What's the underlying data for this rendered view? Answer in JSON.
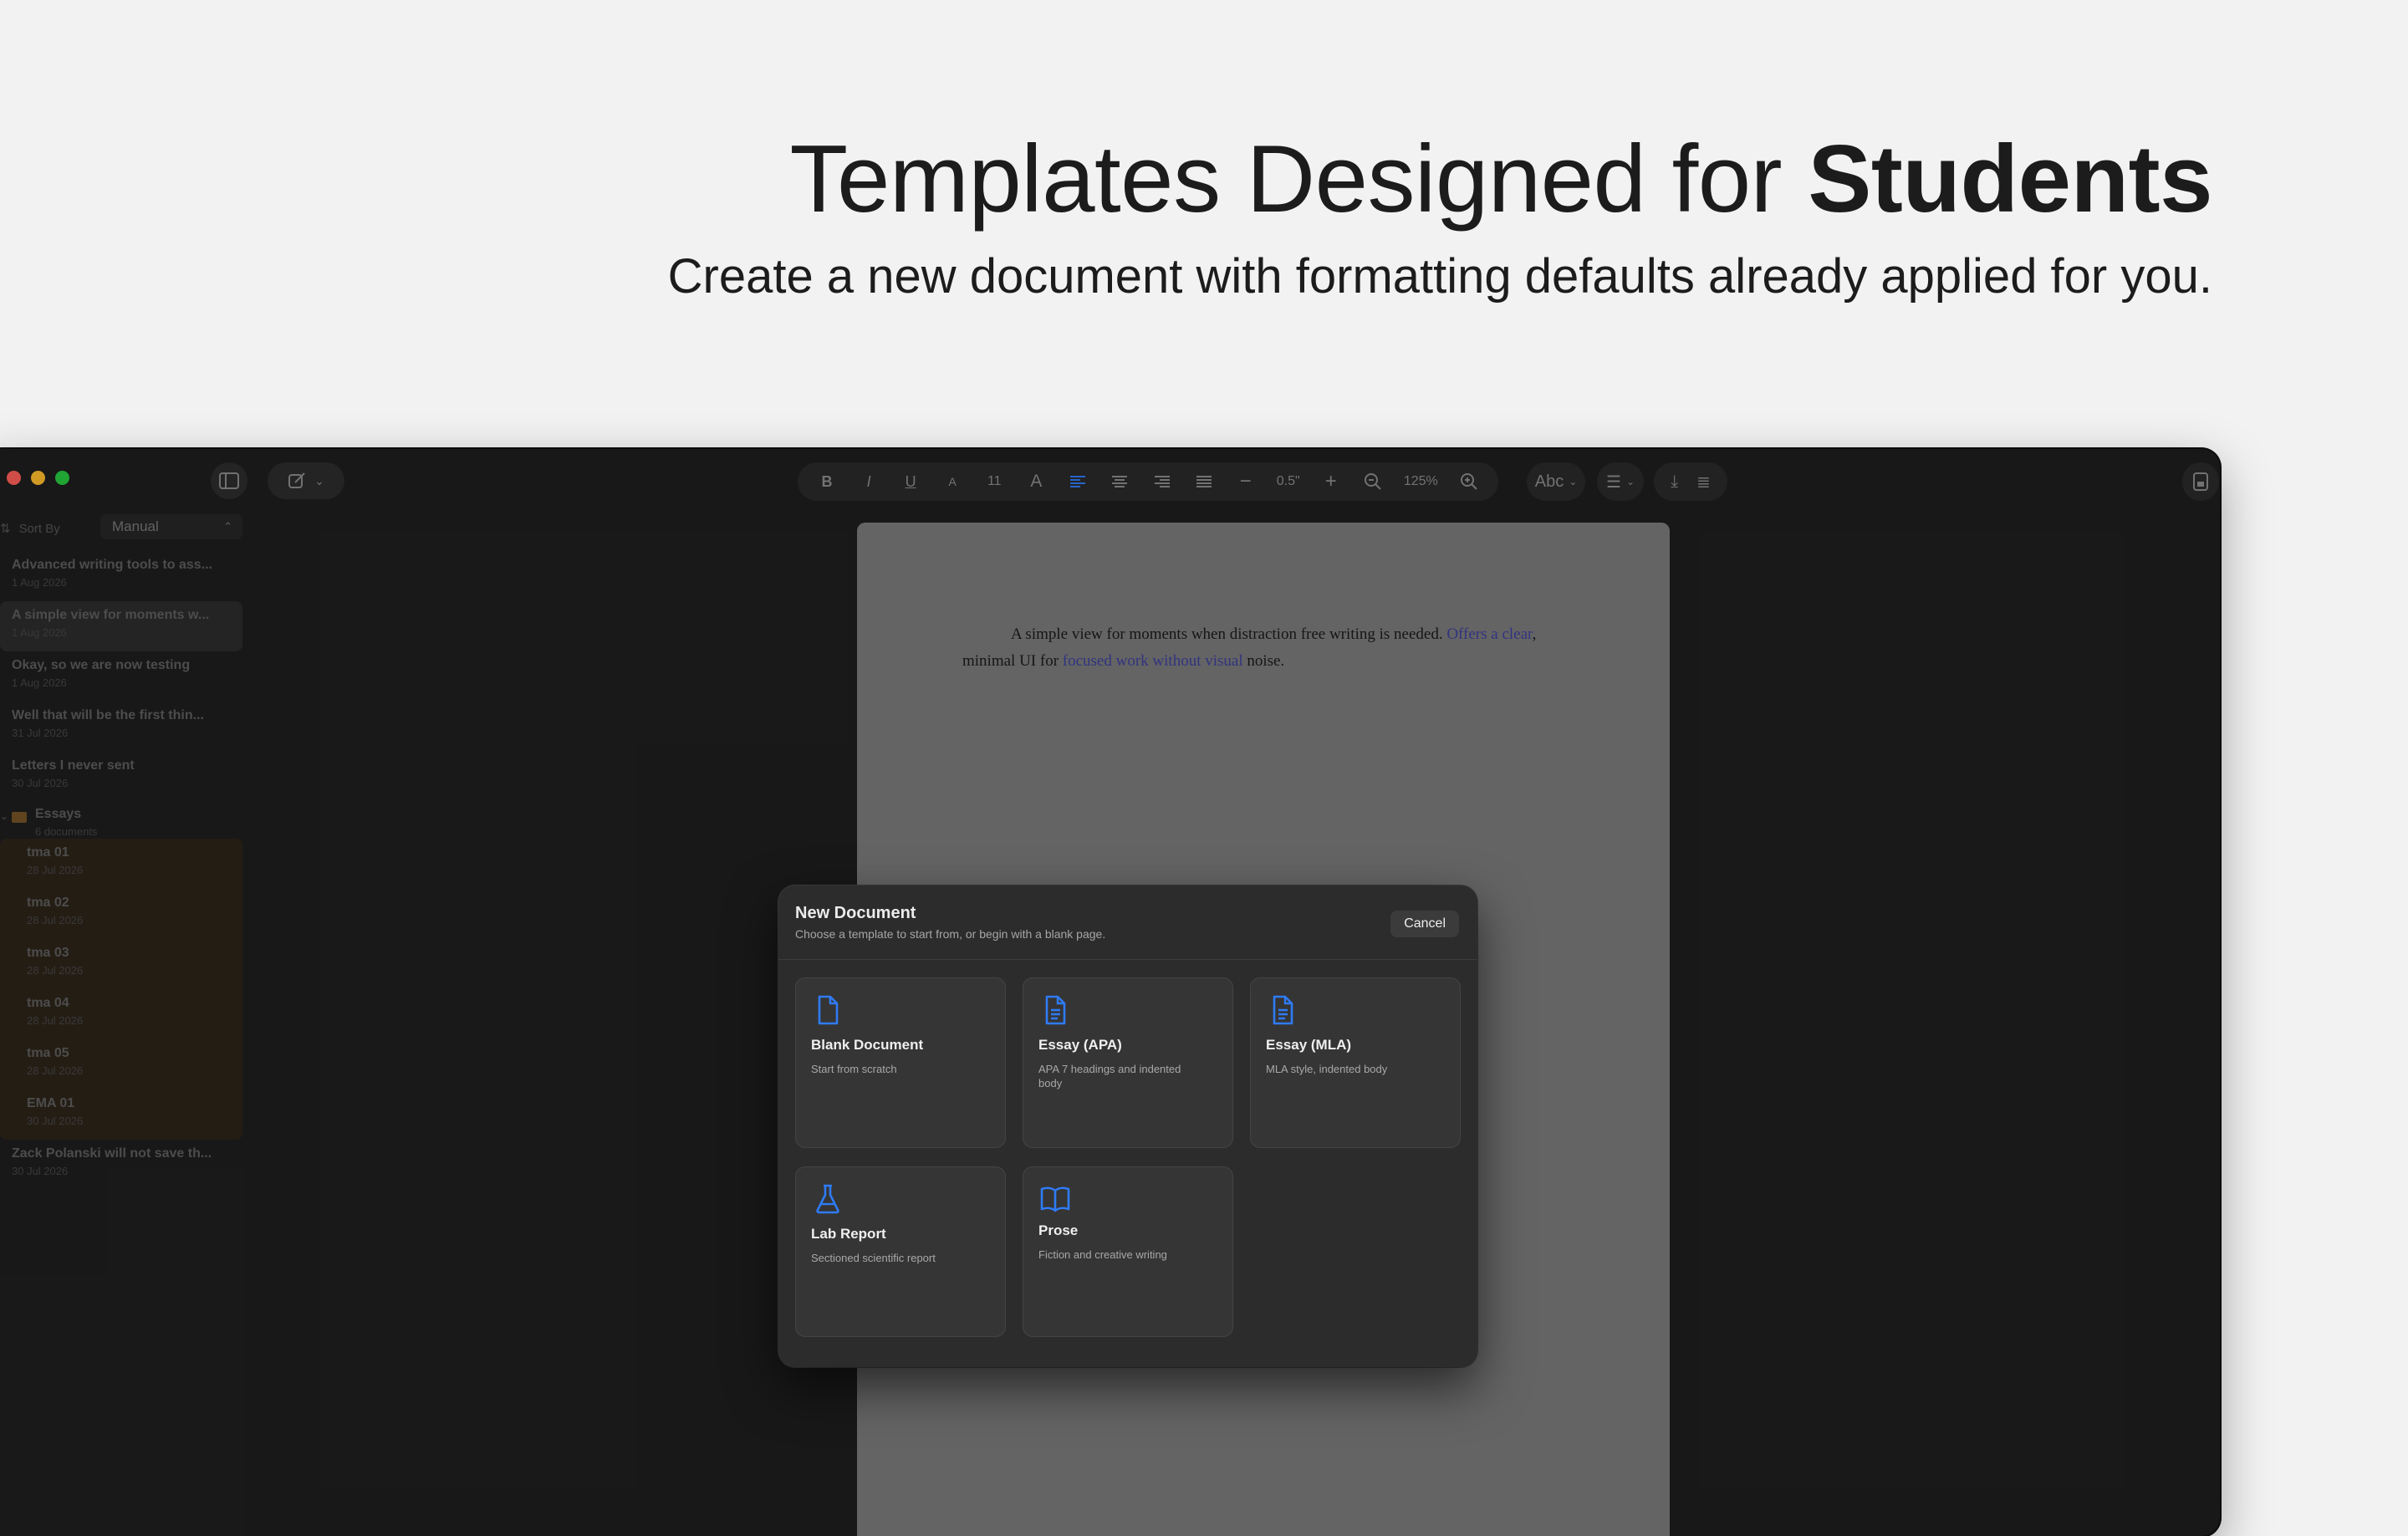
{
  "hero": {
    "title_plain": "Templates Designed for ",
    "title_bold": "Students",
    "subtitle": "Create a new document with formatting defaults already applied for you."
  },
  "sidebar": {
    "sort_label": "Sort By",
    "sort_value": "Manual",
    "documents": [
      {
        "title": "Advanced writing tools to ass...",
        "date": "1 Aug 2026"
      },
      {
        "title": "A simple view for moments w...",
        "date": "1 Aug 2026",
        "selected": true
      },
      {
        "title": "Okay, so we are now testing",
        "date": "1 Aug 2026"
      },
      {
        "title": "Well that will be the first thin...",
        "date": "31 Jul 2026"
      },
      {
        "title": "Letters I never sent",
        "date": "30 Jul 2026"
      }
    ],
    "folder": {
      "name": "Essays",
      "count": "6 documents",
      "items": [
        {
          "title": "tma 01",
          "date": "28 Jul 2026"
        },
        {
          "title": "tma 02",
          "date": "28 Jul 2026"
        },
        {
          "title": "tma 03",
          "date": "28 Jul 2026"
        },
        {
          "title": "tma 04",
          "date": "28 Jul 2026"
        },
        {
          "title": "tma 05",
          "date": "28 Jul 2026"
        },
        {
          "title": "EMA 01",
          "date": "30 Jul 2026"
        }
      ]
    },
    "after_folder": [
      {
        "title": "Zack Polanski will not save th...",
        "date": "30 Jul 2026"
      }
    ]
  },
  "toolbar": {
    "bold": "B",
    "italic": "I",
    "underline": "U",
    "font_small": "A",
    "font_size": "11",
    "font_large": "A",
    "line_spacing": "0.5\"",
    "zoom": "125%",
    "spellcheck": "Abc"
  },
  "page": {
    "text_plain_1": "A simple view for moments when distraction free writing is needed. ",
    "text_link_1": "Offers a clear",
    "text_plain_2": ", minimal UI for ",
    "text_link_2": "focused work without visual",
    "text_plain_3": " noise."
  },
  "dialog": {
    "title": "New Document",
    "subtitle": "Choose a template to start from, or begin with a blank page.",
    "cancel": "Cancel",
    "templates": [
      {
        "title": "Blank Document",
        "desc": "Start from scratch",
        "icon": "document-icon"
      },
      {
        "title": "Essay (APA)",
        "desc": "APA 7 headings and indented body",
        "icon": "text-document-icon"
      },
      {
        "title": "Essay (MLA)",
        "desc": "MLA style, indented body",
        "icon": "text-document-icon"
      },
      {
        "title": "Lab Report",
        "desc": "Sectioned scientific report",
        "icon": "flask-icon"
      },
      {
        "title": "Prose",
        "desc": "Fiction and creative writing",
        "icon": "book-icon"
      }
    ]
  },
  "colors": {
    "accent": "#2f7bf5",
    "traffic_red": "#ff5f57",
    "traffic_yellow": "#febc2e",
    "traffic_green": "#28c840",
    "folder_highlight": "#3d2a16"
  }
}
